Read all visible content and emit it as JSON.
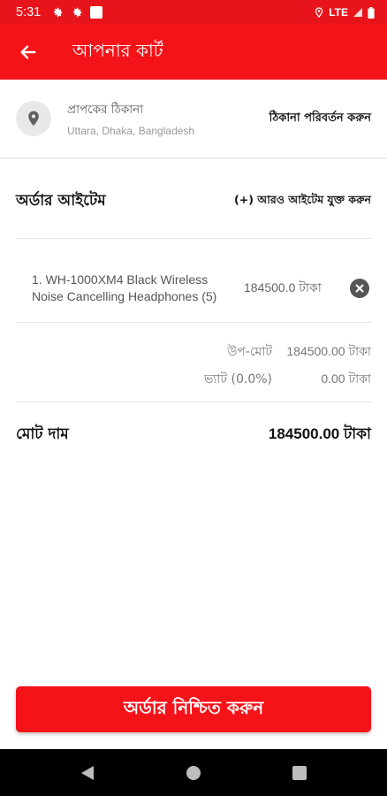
{
  "status_bar": {
    "time": "5:31",
    "network": "LTE",
    "icons": [
      "settings-icon",
      "settings-icon",
      "notification-square-icon",
      "location-icon",
      "signal-icon",
      "battery-icon"
    ]
  },
  "app_bar": {
    "title": "আপনার কার্ট",
    "back_icon": "arrow-left-icon"
  },
  "address": {
    "label": "প্রাপকের ঠিকানা",
    "value": "Uttara, Dhaka, Bangladesh",
    "change_label": "ঠিকানা পরিবর্তন করুন",
    "icon": "location-pin-icon"
  },
  "order_items": {
    "title": "অর্ডার আইটেম",
    "add_more_label": "(+) আরও আইটেম যুক্ত করুন",
    "items": [
      {
        "name": "1. WH-1000XM4 Black Wireless Noise Cancelling Headphones (5)",
        "price": "184500.0 টাকা"
      }
    ]
  },
  "summary": {
    "subtotal_label": "উপ-মোট",
    "subtotal_value": "184500.00 টাকা",
    "vat_label": "ভ্যাট (0.0%)",
    "vat_value": "0.00 টাকা",
    "total_label": "মোট দাম",
    "total_value": "184500.00 টাকা"
  },
  "confirm_button_label": "অর্ডার নিশ্চিত করুন",
  "colors": {
    "primary": "#f5131a",
    "status_bar": "#e8141b"
  }
}
